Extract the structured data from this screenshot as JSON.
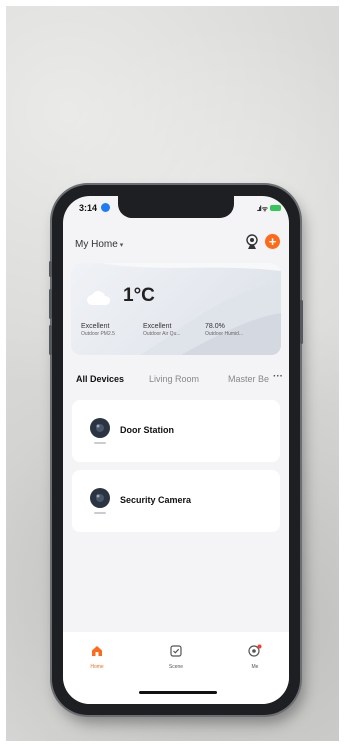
{
  "status_bar": {
    "time": "3:14",
    "signal": "..ıl ᯤ"
  },
  "header": {
    "home_label": "My Home",
    "caret": "▾",
    "add_symbol": "+"
  },
  "weather": {
    "temperature": "1°C",
    "metrics": [
      {
        "value": "Excellent",
        "label": "Outdoor PM2.5"
      },
      {
        "value": "Excellent",
        "label": "Outdoor Air Qu..."
      },
      {
        "value": "78.0%",
        "label": "Outdoor Humid..."
      }
    ]
  },
  "tabs": {
    "items": [
      "All Devices",
      "Living Room",
      "Master Be"
    ],
    "more": "···"
  },
  "devices": [
    {
      "name": "Door Station",
      "icon": "camera-icon"
    },
    {
      "name": "Security Camera",
      "icon": "camera-icon"
    }
  ],
  "bottom_nav": {
    "items": [
      {
        "label": "Home",
        "icon": "home-icon"
      },
      {
        "label": "Scene",
        "icon": "scene-check-icon"
      },
      {
        "label": "Me",
        "icon": "profile-icon"
      }
    ]
  },
  "colors": {
    "accent": "#ff6a1a",
    "battery": "#35c759",
    "location": "#1e7cf6"
  }
}
